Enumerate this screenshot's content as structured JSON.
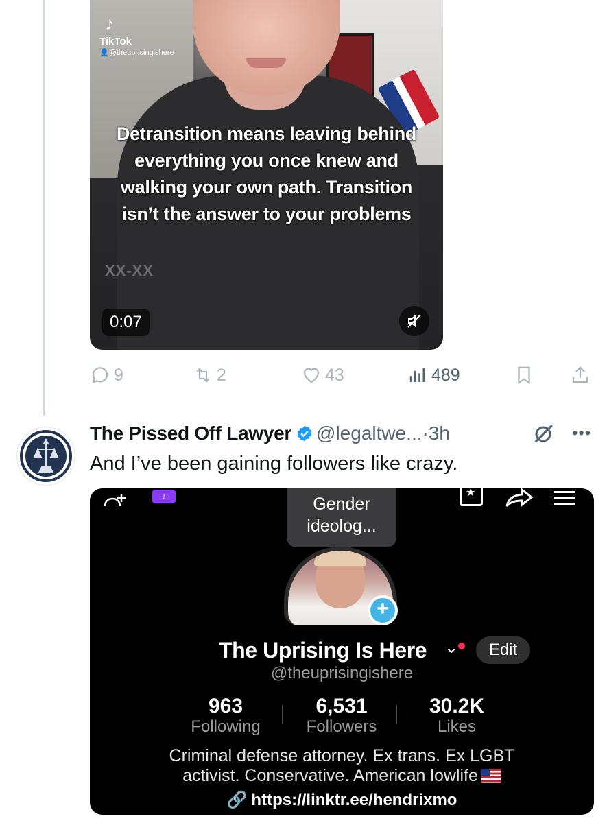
{
  "first_tweet": {
    "video": {
      "app_name": "TikTok",
      "tiktok_handle": "@theuprisingishere",
      "caption": "Detransition means leaving behind everything you once knew and walking your own path. Transition isn’t the answer to your problems",
      "brand_mark": "XX-XX",
      "duration": "0:07",
      "muted": true
    },
    "actions": {
      "replies": "9",
      "reposts": "2",
      "likes": "43",
      "views": "489"
    }
  },
  "second_tweet": {
    "author": "The Pissed Off Lawyer",
    "verified": true,
    "handle": "@legaltwe...",
    "separator": "·",
    "age": "3h",
    "text": "And I’ve been gaining followers like crazy.",
    "profile": {
      "tooltip": "Gender ideolog...",
      "name": "The Uprising Is Here",
      "edit_label": "Edit",
      "handle": "@theuprisingishere",
      "stats": [
        {
          "value": "963",
          "label": "Following"
        },
        {
          "value": "6,531",
          "label": "Followers"
        },
        {
          "value": "30.2K",
          "label": "Likes"
        }
      ],
      "bio_line1": "Criminal defense attorney. Ex trans. Ex LGBT",
      "bio_line2": "activist. Conservative. American lowlife",
      "link": "https://linktr.ee/hendrixmo"
    }
  },
  "colors": {
    "verified_blue": "#1d9bf0",
    "muted_text": "#536471",
    "action_gray": "#aab5bd",
    "tiktok_badge_purple": "#8a3cf2",
    "story_blue": "#43b4e8"
  }
}
